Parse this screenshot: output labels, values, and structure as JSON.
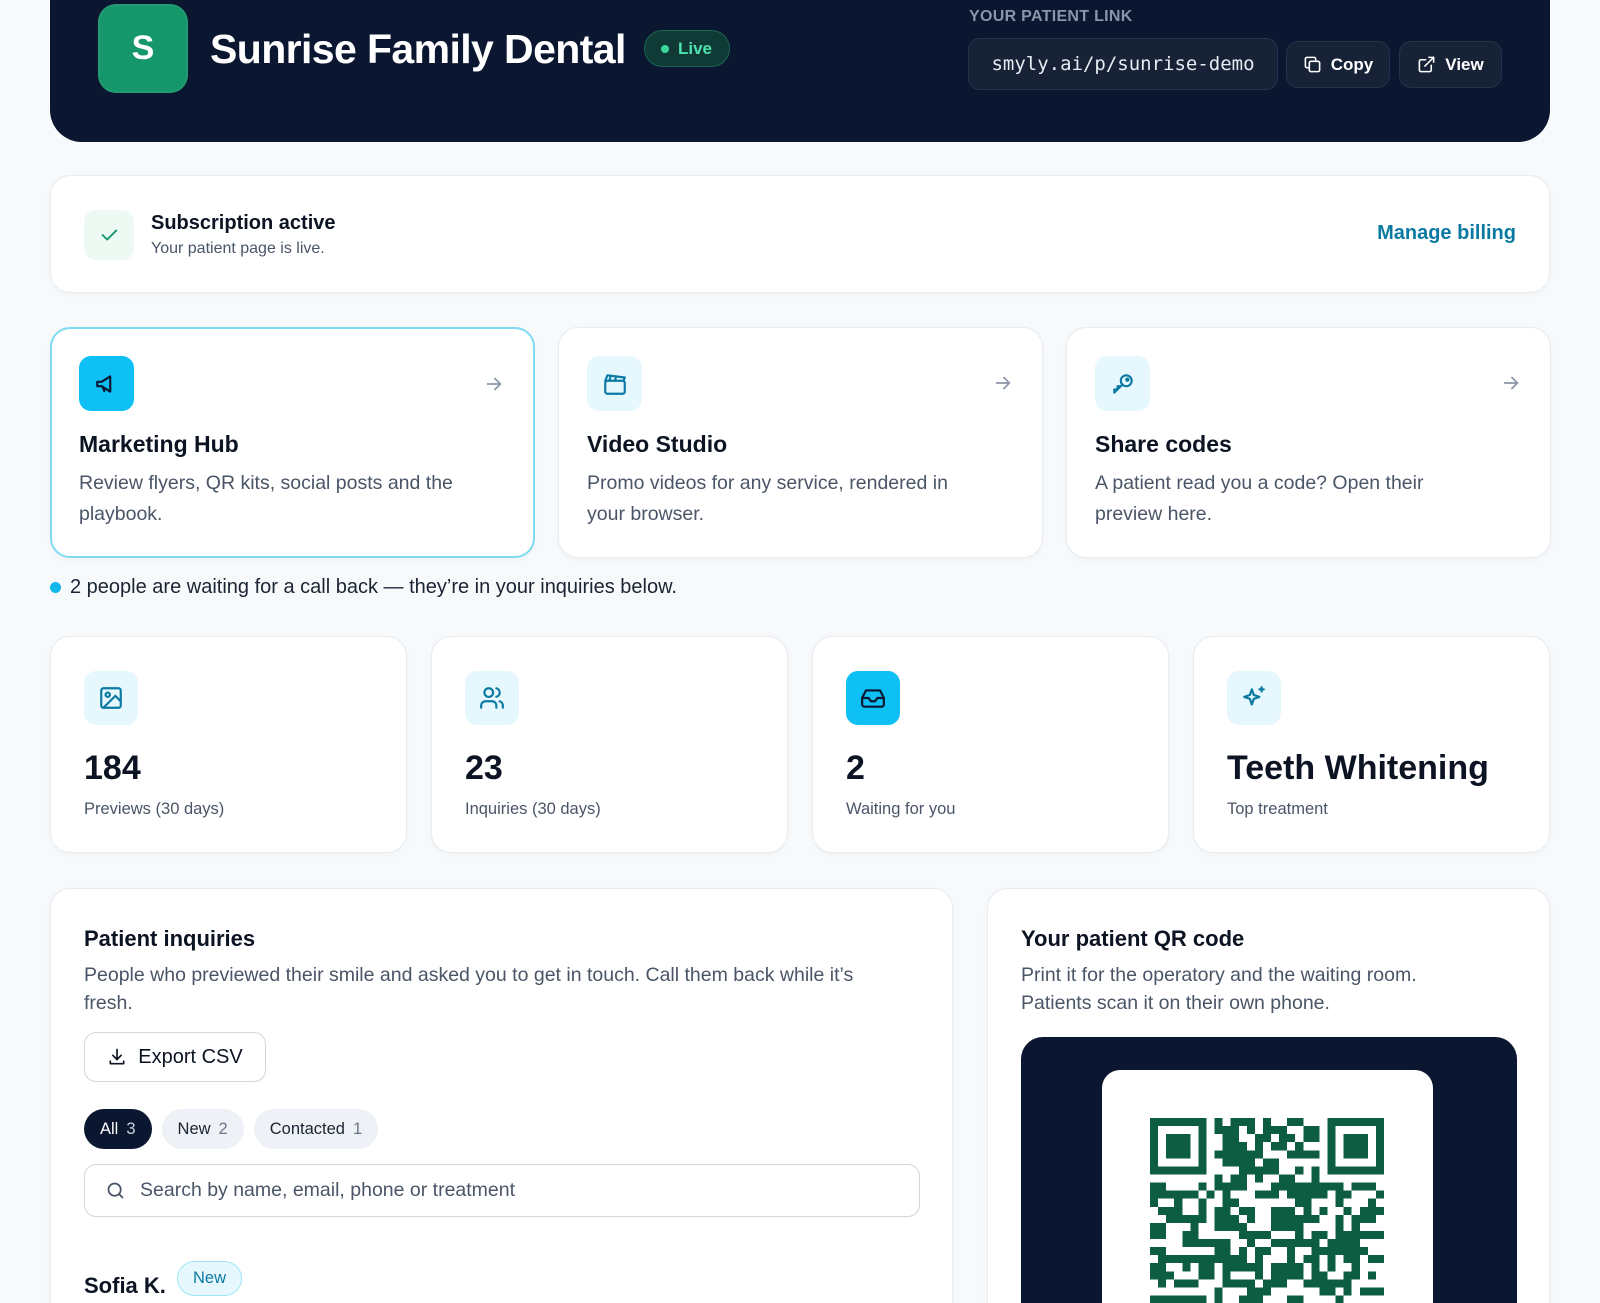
{
  "header": {
    "logo_letter": "S",
    "clinic_name": "Sunrise Family Dental",
    "status_badge": "Live",
    "link_label": "YOUR PATIENT LINK",
    "patient_link": "smyly.ai/p/sunrise-demo",
    "copy_label": "Copy",
    "view_label": "View"
  },
  "subscription": {
    "title": "Subscription active",
    "text": "Your patient page is live.",
    "manage_label": "Manage billing"
  },
  "features": [
    {
      "icon": "megaphone-icon",
      "title": "Marketing Hub",
      "desc": "Review flyers, QR kits, social posts and the playbook."
    },
    {
      "icon": "clapperboard-icon",
      "title": "Video Studio",
      "desc": "Promo videos for any service, rendered in your browser."
    },
    {
      "icon": "key-icon",
      "title": "Share codes",
      "desc": "A patient read you a code? Open their preview here."
    }
  ],
  "notice": "2 people are waiting for a call back — they’re in your inquiries below.",
  "stats": [
    {
      "icon": "image-icon",
      "value": "184",
      "label": "Previews (30 days)"
    },
    {
      "icon": "users-icon",
      "value": "23",
      "label": "Inquiries (30 days)"
    },
    {
      "icon": "inbox-icon",
      "value": "2",
      "label": "Waiting for you"
    },
    {
      "icon": "sparkles-icon",
      "value": "Teeth Whitening",
      "label": "Top treatment"
    }
  ],
  "inquiries": {
    "title": "Patient inquiries",
    "desc": "People who previewed their smile and asked you to get in touch. Call them back while it’s fresh.",
    "export_label": "Export CSV",
    "filters": [
      {
        "label": "All",
        "count": "3"
      },
      {
        "label": "New",
        "count": "2"
      },
      {
        "label": "Contacted",
        "count": "1"
      }
    ],
    "search_placeholder": "Search by name, email, phone or treatment",
    "rows": [
      {
        "name": "Sofia K.",
        "status": "New"
      }
    ]
  },
  "qr": {
    "title": "Your patient QR code",
    "desc": "Print it for the operatory and the waiting room. Patients scan it on their own phone."
  },
  "colors": {
    "header_bg": "#0b1630",
    "logo_bg": "#16966b",
    "accent": "#0ec0f3",
    "link": "#0b7aa3",
    "qr_modules": "#0d5d43"
  }
}
